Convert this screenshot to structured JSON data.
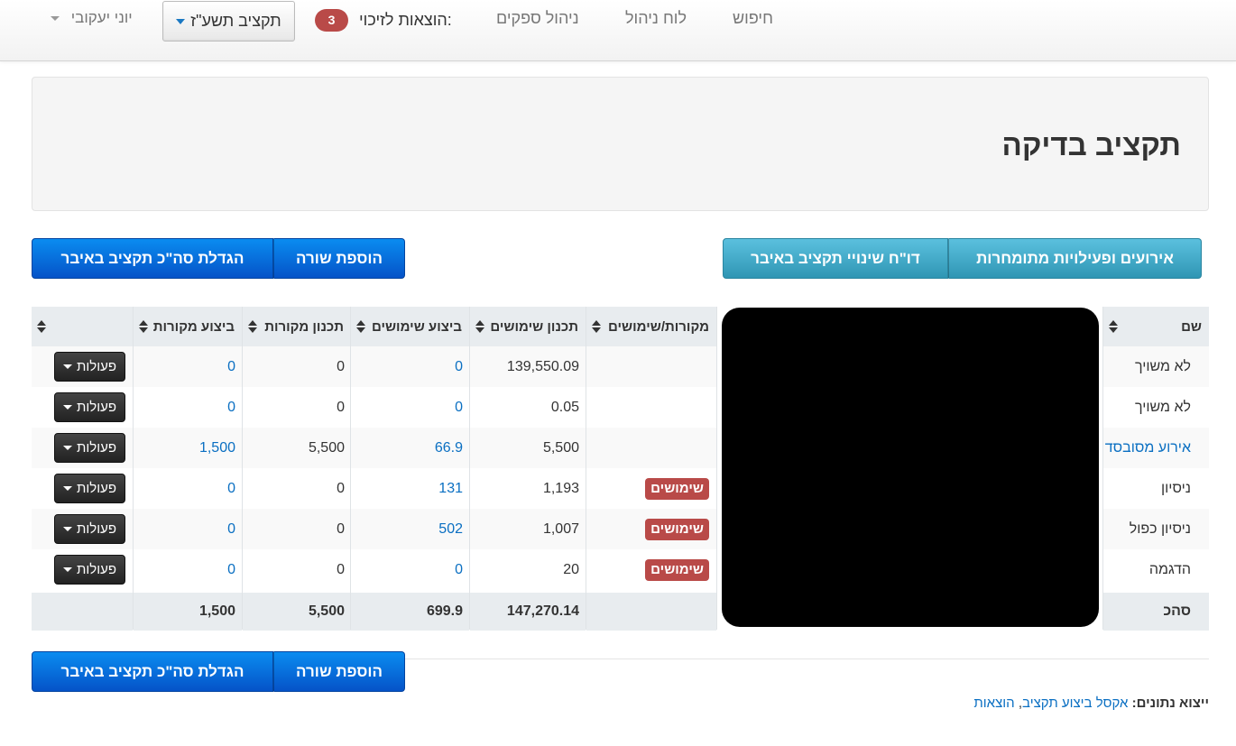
{
  "nav": {
    "search": "חיפוש",
    "dashboard": "לוח ניהול",
    "suppliers": "ניהול ספקים",
    "expenses_label": "הוצאות לזיכוי:",
    "expenses_count": "3",
    "budget_select": "תקציב תשע\"ז",
    "user_name": "יוני יעקובי"
  },
  "page": {
    "title": "תקציב בדיקה"
  },
  "buttons": {
    "add_row": "הוספת שורה",
    "increase_total": "הגדלת סה\"כ תקציב באיבר",
    "events": "אירועים ופעילויות מתומחרות",
    "changes_report": "דו\"ח שינויי תקציב באיבר"
  },
  "table": {
    "headers": {
      "name": "שם",
      "sources_uses": "מקורות/שימושים",
      "planned_uses": "תכנון שימושים",
      "actual_uses": "ביצוע שימושים",
      "planned_sources": "תכנון מקורות",
      "actual_sources": "ביצוע מקורות"
    },
    "action_label": "פעולות",
    "rows": [
      {
        "name": "לא משויך",
        "type": "",
        "planned_uses": "139,550.09",
        "actual_uses": "0",
        "planned_sources": "0",
        "actual_sources": "0"
      },
      {
        "name": "לא משויך",
        "type": "",
        "planned_uses": "0.05",
        "actual_uses": "0",
        "planned_sources": "0",
        "actual_sources": "0"
      },
      {
        "name": "אירוע מסובסד",
        "type": "",
        "planned_uses": "5,500",
        "actual_uses": "66.9",
        "planned_sources": "5,500",
        "actual_sources": "1,500"
      },
      {
        "name": "ניסיון",
        "type": "שימושים",
        "planned_uses": "1,193",
        "actual_uses": "131",
        "planned_sources": "0",
        "actual_sources": "0"
      },
      {
        "name": "ניסיון כפול",
        "type": "שימושים",
        "planned_uses": "1,007",
        "actual_uses": "502",
        "planned_sources": "0",
        "actual_sources": "0"
      },
      {
        "name": "הדגמה",
        "type": "שימושים",
        "planned_uses": "20",
        "actual_uses": "0",
        "planned_sources": "0",
        "actual_sources": "0"
      }
    ],
    "totals": {
      "name": "סהכ",
      "planned_uses": "147,270.14",
      "actual_uses": "699.9",
      "planned_sources": "5,500",
      "actual_sources": "1,500"
    }
  },
  "export": {
    "label": "ייצוא נתונים:",
    "link1": "אקסל ביצוע תקציב",
    "separator": ", ",
    "link2": "הוצאות"
  }
}
